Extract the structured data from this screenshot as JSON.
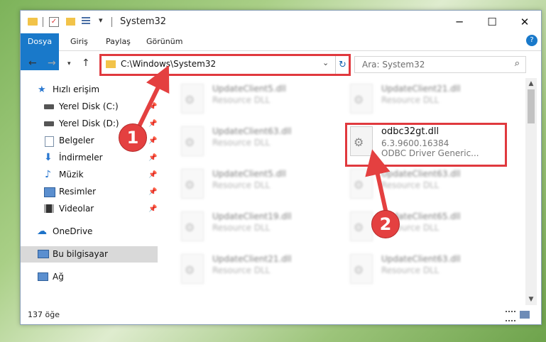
{
  "window": {
    "title": "System32",
    "controls": {
      "minimize": "─",
      "maximize": "☐",
      "close": "✕"
    }
  },
  "ribbon": {
    "tabs": [
      {
        "label": "Dosya"
      },
      {
        "label": "Giriş"
      },
      {
        "label": "Paylaş"
      },
      {
        "label": "Görünüm"
      }
    ]
  },
  "address": {
    "path": "C:\\Windows\\System32",
    "search_placeholder": "Ara: System32"
  },
  "sidebar": {
    "items": [
      {
        "label": "Hızlı erişim",
        "icon": "star-icon"
      },
      {
        "label": "Yerel Disk (C:)",
        "icon": "drive-icon"
      },
      {
        "label": "Yerel Disk (D:)",
        "icon": "drive-icon"
      },
      {
        "label": "Belgeler",
        "icon": "documents-icon"
      },
      {
        "label": "İndirmeler",
        "icon": "download-icon"
      },
      {
        "label": "Müzik",
        "icon": "music-icon"
      },
      {
        "label": "Resimler",
        "icon": "pictures-icon"
      },
      {
        "label": "Videolar",
        "icon": "video-icon"
      },
      {
        "label": "OneDrive",
        "icon": "cloud-icon"
      },
      {
        "label": "Bu bilgisayar",
        "icon": "computer-icon"
      },
      {
        "label": "Ağ",
        "icon": "network-icon"
      }
    ]
  },
  "files": [
    {
      "name": "UpdateClient5.dll",
      "desc": "Resource DLL"
    },
    {
      "name": "UpdateClient21.dll",
      "desc": "Resource DLL"
    },
    {
      "name": "UpdateClient63.dll",
      "desc": "Resource DLL"
    },
    {
      "name": "odbc32gt.dll",
      "version": "6.3.9600.16384",
      "desc": "ODBC Driver Generic..."
    },
    {
      "name": "UpdateClient5.dll",
      "desc": "Resource DLL"
    },
    {
      "name": "UpdateClient63.dll",
      "desc": "Resource DLL"
    },
    {
      "name": "UpdateClient19.dll",
      "desc": "Resource DLL"
    },
    {
      "name": "UpdateClient65.dll",
      "desc": "Resource DLL"
    },
    {
      "name": "UpdateClient21.dll",
      "desc": "Resource DLL"
    },
    {
      "name": "UpdateClient63.dll",
      "desc": "Resource DLL"
    }
  ],
  "status": {
    "count": "137 öğe"
  },
  "annotations": {
    "badge1": "1",
    "badge2": "2"
  },
  "colors": {
    "accent": "#1979ca",
    "highlight": "#e0393e",
    "folder": "#f2c349"
  }
}
